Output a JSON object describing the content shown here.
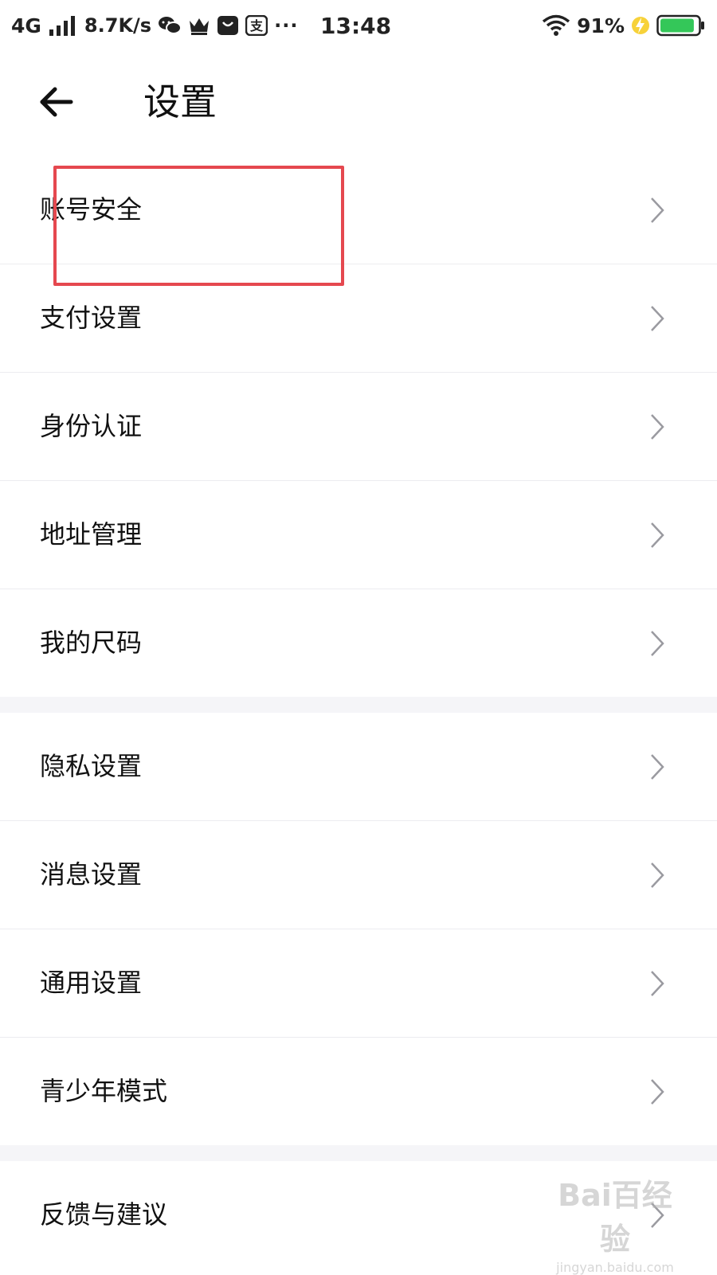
{
  "status_bar": {
    "network": "4G",
    "speed": "8.7K/s",
    "more": "···",
    "time": "13:48",
    "battery_percent": "91%",
    "battery_level": 0.91,
    "icons": [
      "signal-icon",
      "wechat-icon",
      "crown-icon",
      "app-box-icon",
      "alipay-icon",
      "wifi-icon",
      "charging-icon",
      "battery-icon"
    ]
  },
  "header": {
    "title": "设置",
    "back_icon": "arrow-left-icon"
  },
  "menu": {
    "group1": [
      {
        "label": "账号安全"
      },
      {
        "label": "支付设置"
      },
      {
        "label": "身份认证"
      },
      {
        "label": "地址管理"
      },
      {
        "label": "我的尺码"
      }
    ],
    "group2": [
      {
        "label": "隐私设置"
      },
      {
        "label": "消息设置"
      },
      {
        "label": "通用设置"
      },
      {
        "label": "青少年模式"
      }
    ],
    "group3": [
      {
        "label": "反馈与建议"
      }
    ]
  },
  "annotation": {
    "highlight_color": "#e5484f"
  },
  "watermark": {
    "logo": "Bai百经验",
    "sub": "jingyan.baidu.com"
  }
}
